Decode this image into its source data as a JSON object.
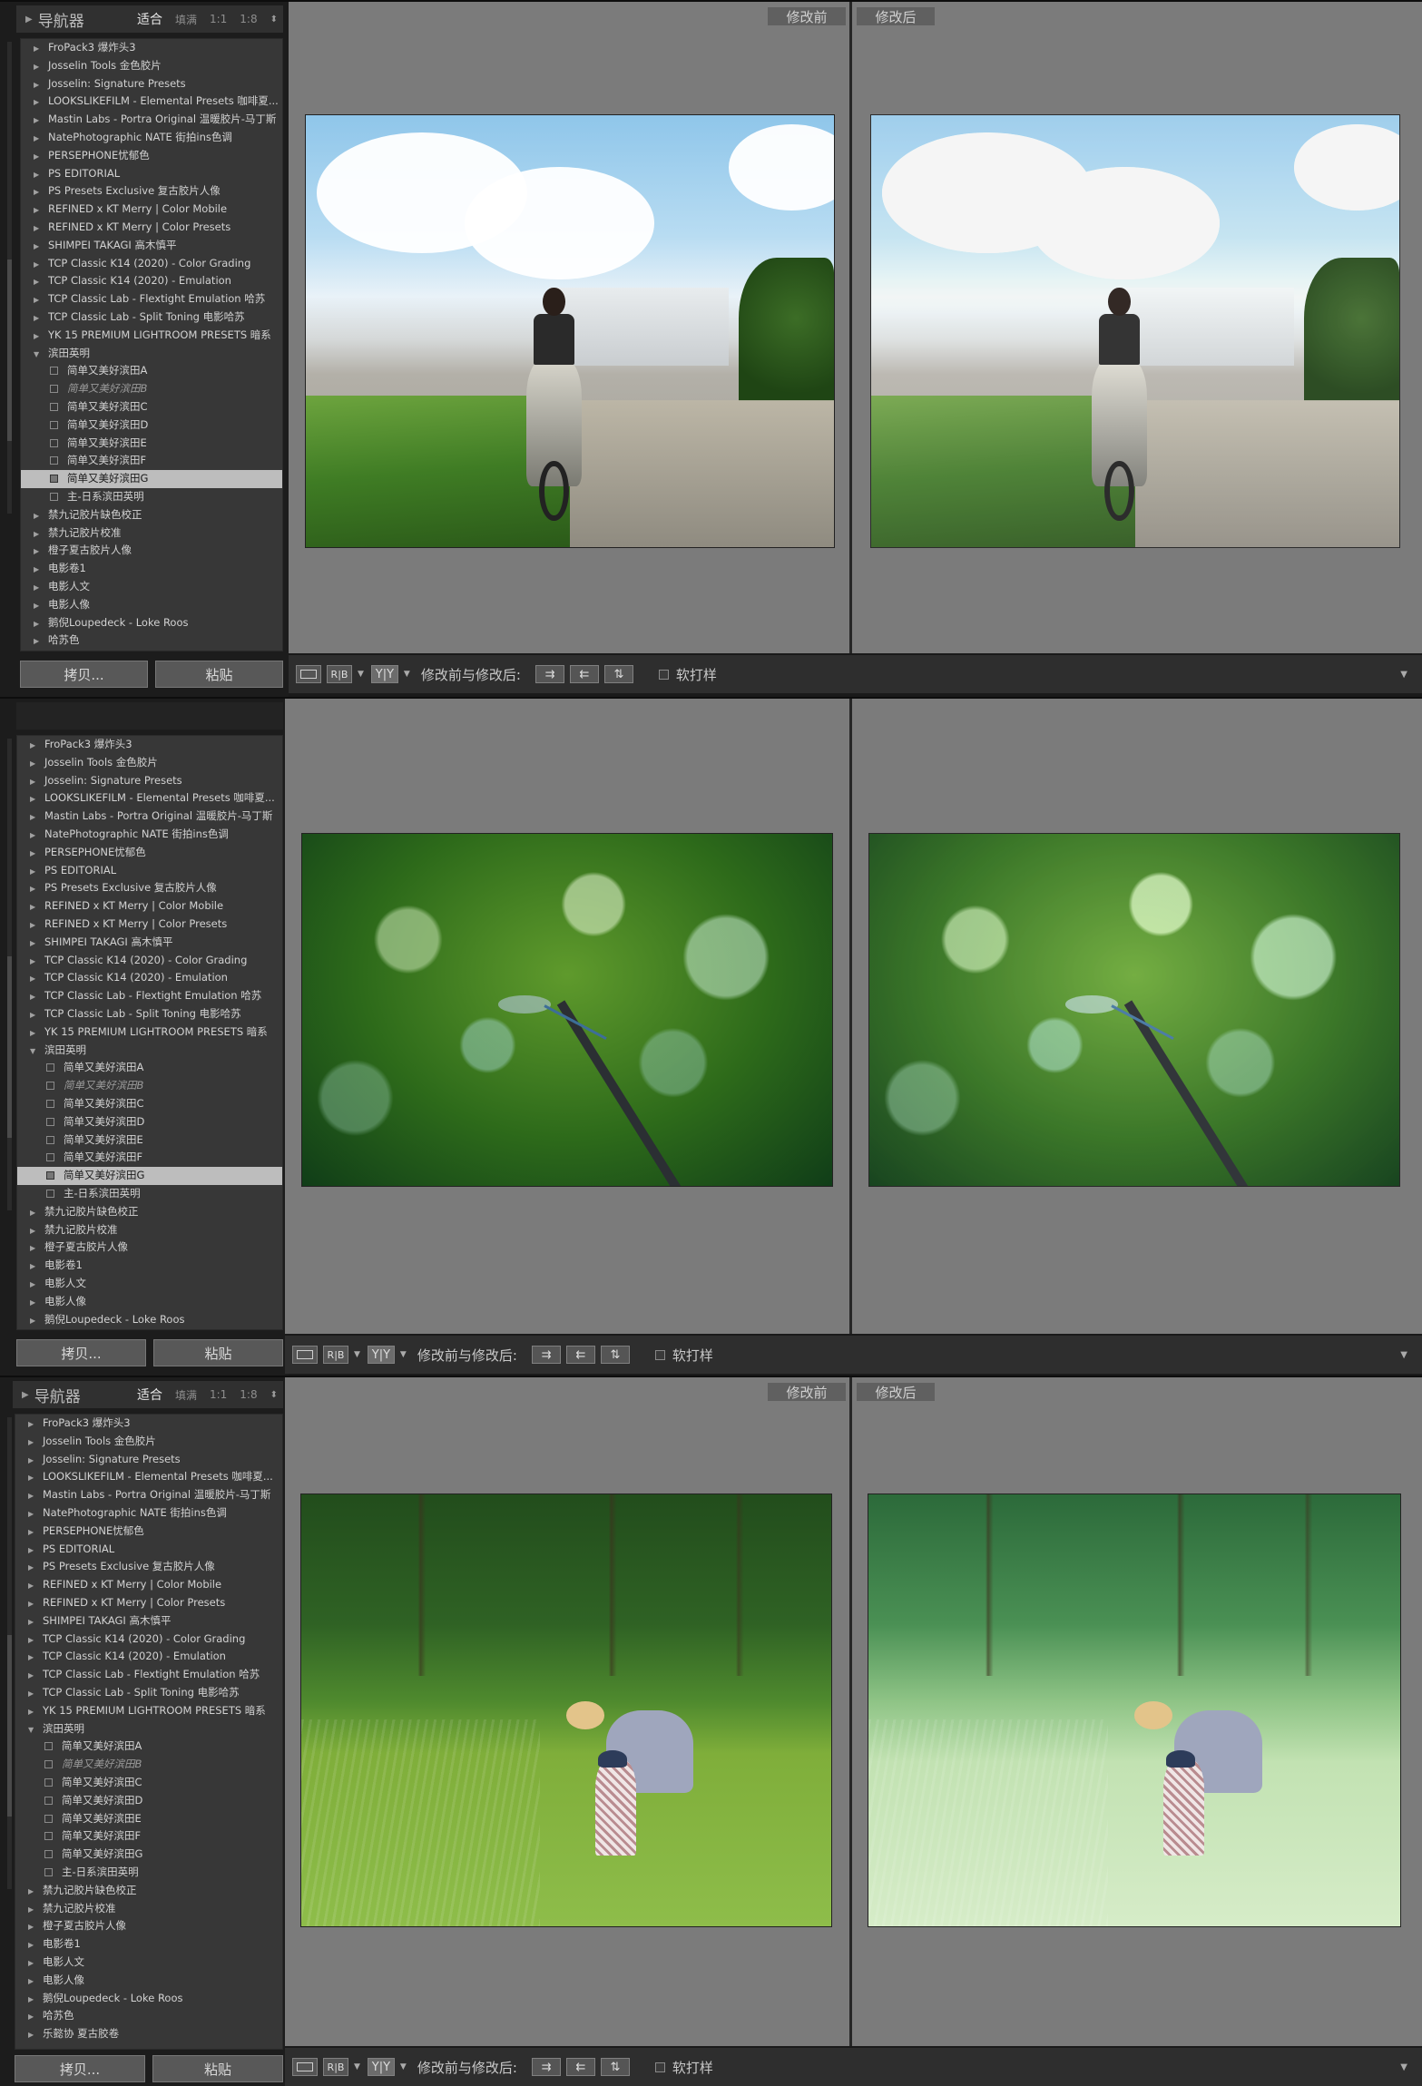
{
  "navigator": {
    "title": "导航器",
    "fit": "适合",
    "fill": "填满",
    "ratio_1": "1:1",
    "ratio_2": "1:8"
  },
  "presets": [
    {
      "label": "FroPack3    爆炸头3",
      "type": "folder"
    },
    {
      "label": "Josselin Tools 金色胶片",
      "type": "folder"
    },
    {
      "label": "Josselin: Signature Presets",
      "type": "folder"
    },
    {
      "label": "LOOKSLIKEFILM - Elemental Presets 咖啡夏...",
      "type": "folder"
    },
    {
      "label": "Mastin Labs - Portra Original 温暖胶片-马丁斯",
      "type": "folder"
    },
    {
      "label": "NatePhotographic NATE 街拍ins色调",
      "type": "folder"
    },
    {
      "label": "PERSEPHONE忧郁色",
      "type": "folder"
    },
    {
      "label": "PS EDITORIAL",
      "type": "folder"
    },
    {
      "label": "PS Presets Exclusive 复古胶片人像",
      "type": "folder"
    },
    {
      "label": "REFINED x KT Merry | Color Mobile",
      "type": "folder"
    },
    {
      "label": "REFINED x KT Merry | Color Presets",
      "type": "folder"
    },
    {
      "label": "SHIMPEI TAKAGI 高木慎平",
      "type": "folder"
    },
    {
      "label": "TCP Classic K14 (2020) - Color Grading",
      "type": "folder"
    },
    {
      "label": "TCP Classic K14 (2020) - Emulation",
      "type": "folder"
    },
    {
      "label": "TCP Classic Lab - Flextight Emulation 哈苏",
      "type": "folder"
    },
    {
      "label": "TCP Classic Lab - Split Toning 电影哈苏",
      "type": "folder"
    },
    {
      "label": "YK 15 PREMIUM LIGHTROOM PRESETS 暗系",
      "type": "folder"
    },
    {
      "label": "滨田英明",
      "type": "open"
    },
    {
      "label": "简单又美好滨田A",
      "type": "child"
    },
    {
      "label": "简单又美好滨田B",
      "type": "child-italic"
    },
    {
      "label": "简单又美好滨田C",
      "type": "child"
    },
    {
      "label": "简单又美好滨田D",
      "type": "child"
    },
    {
      "label": "简单又美好滨田E",
      "type": "child"
    },
    {
      "label": "简单又美好滨田F",
      "type": "child"
    },
    {
      "label": "简单又美好滨田G",
      "type": "child-selected"
    },
    {
      "label": "主-日系滨田英明",
      "type": "child"
    },
    {
      "label": "禁九记胶片缺色校正",
      "type": "folder"
    },
    {
      "label": "禁九记胶片校准",
      "type": "folder"
    },
    {
      "label": "橙子夏古胶片人像",
      "type": "folder"
    },
    {
      "label": "电影卷1",
      "type": "folder"
    },
    {
      "label": "电影人文",
      "type": "folder"
    },
    {
      "label": "电影人像",
      "type": "folder"
    },
    {
      "label": "鹅倪Loupedeck - Loke Roos",
      "type": "folder"
    },
    {
      "label": "哈苏色",
      "type": "folder"
    },
    {
      "label": "乐懿协 夏古胶卷",
      "type": "folder"
    }
  ],
  "buttons": {
    "copy": "拷贝...",
    "paste": "粘贴"
  },
  "compare": {
    "before": "修改前",
    "after": "修改后"
  },
  "toolbar": {
    "yy": "Y|Y",
    "rb": "R|B",
    "mode": "修改前与修改后:",
    "soft_proof": "软打样"
  },
  "screens": [
    {
      "photo": "motorcycle-rider",
      "selected_preset": 24
    },
    {
      "photo": "dragonfly",
      "selected_preset": 24
    },
    {
      "photo": "rice-field-mother-child",
      "selected_preset": -1
    }
  ]
}
